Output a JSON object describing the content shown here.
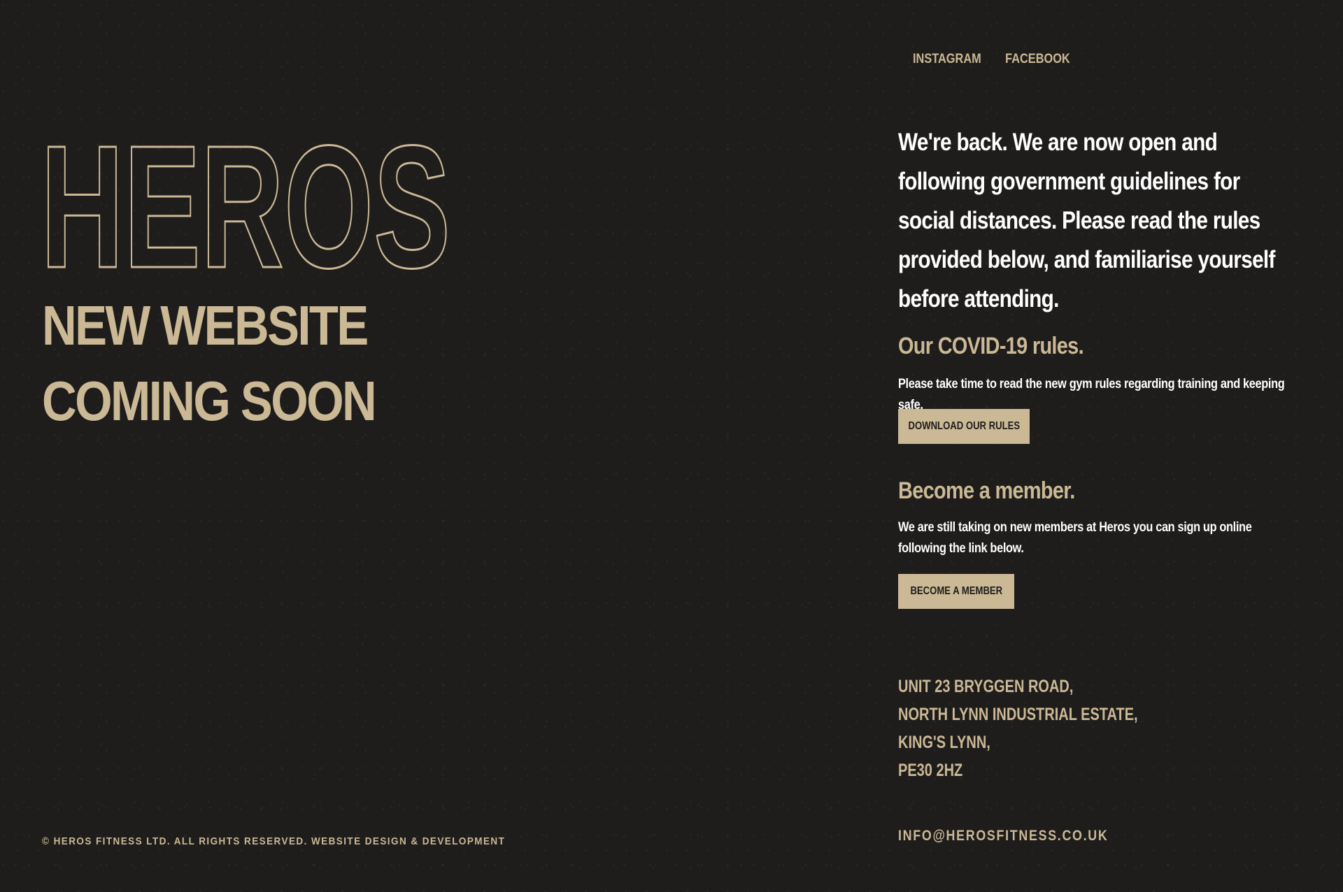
{
  "brand": {
    "logo_text": "HEROS",
    "headline_lines": [
      "NEW WEBSITE",
      "COMING SOON"
    ],
    "accent_color": "#cbb895",
    "background_color": "#1e1d1c"
  },
  "social": {
    "items": [
      {
        "label": "INSTAGRAM"
      },
      {
        "label": "FACEBOOK"
      }
    ]
  },
  "intro": {
    "text": "We're back. We are now open and following government guidelines for social distances. Please read the rules provided below, and familiarise yourself before attending."
  },
  "covid": {
    "title": "Our COVID-19 rules.",
    "text": "Please take time to read the new gym rules regarding training and keeping safe.",
    "button_label": "DOWNLOAD OUR RULES"
  },
  "membership": {
    "title": "Become a member.",
    "text": "We are still taking on new members at Heros you can sign up online following the link below.",
    "button_label": "BECOME A MEMBER"
  },
  "address": {
    "lines": [
      "UNIT 23 BRYGGEN ROAD,",
      "NORTH LYNN INDUSTRIAL ESTATE,",
      "KING'S LYNN,",
      "PE30 2HZ"
    ]
  },
  "contact": {
    "email": "INFO@HEROSFITNESS.CO.UK"
  },
  "footer": {
    "copyright": "© HEROS FITNESS LTD. ALL RIGHTS RESERVED. WEBSITE DESIGN & DEVELOPMENT"
  }
}
